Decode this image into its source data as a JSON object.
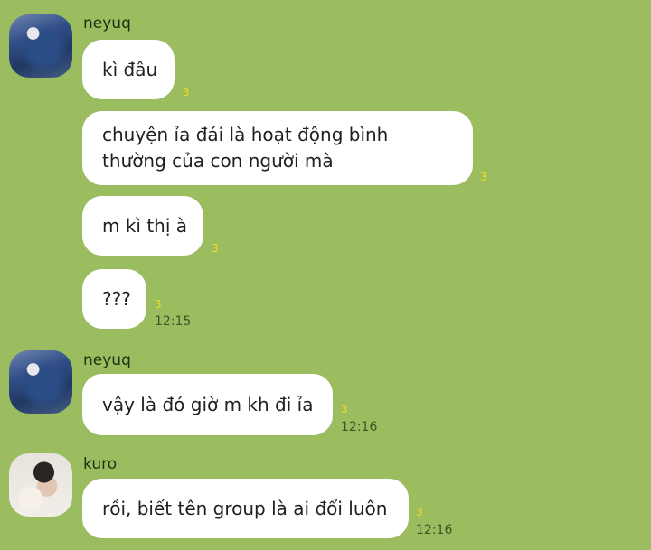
{
  "messages": [
    {
      "sender": "neyuq",
      "text": "kì đâu",
      "read_count": "3",
      "time": ""
    },
    {
      "sender": "",
      "text": "chuyện ỉa đái là hoạt động bình\nthường của con người mà",
      "read_count": "3",
      "time": ""
    },
    {
      "sender": "",
      "text": "m kì thị à",
      "read_count": "3",
      "time": ""
    },
    {
      "sender": "",
      "text": "???",
      "read_count": "3",
      "time": "12:15"
    },
    {
      "sender": "neyuq",
      "text": "vậy là đó giờ m kh đi ỉa",
      "read_count": "3",
      "time": "12:16"
    },
    {
      "sender": "kuro",
      "text": "rồi, biết tên group là ai đổi luôn",
      "read_count": "3",
      "time": "12:16"
    }
  ],
  "colors": {
    "background": "#9bbd5f",
    "bubble": "#ffffff",
    "read_count": "#f1df1f",
    "timestamp": "#3e5627"
  },
  "avatars": [
    {
      "name": "neyuq-avatar"
    },
    {
      "name": "neyuq-avatar"
    },
    {
      "name": "kuro-avatar"
    }
  ]
}
